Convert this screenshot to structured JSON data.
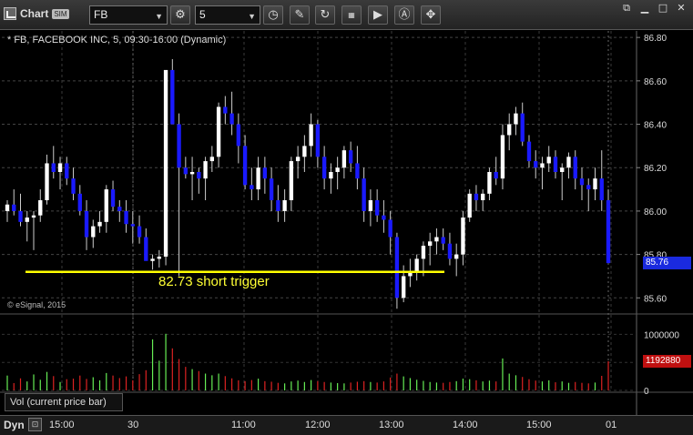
{
  "window": {
    "title": "Chart",
    "badge": "SIM",
    "symbol_value": "FB",
    "interval_value": "5"
  },
  "chart": {
    "title": "* FB, FACEBOOK INC, 5, 09:30-16:00 (Dynamic)",
    "copyright": "© eSignal, 2015",
    "volume_label": "Vol (current price bar)",
    "annotation": "82.73 short trigger",
    "last_price": "85.76",
    "last_volume": "1192880",
    "timebar_mode": "Dyn"
  },
  "colors": {
    "up_candle": "#ffffff",
    "down_candle": "#1a1aff",
    "trigger_line": "#ffff00",
    "vol_up": "#66ee55",
    "vol_down": "#dd2222",
    "last_price_badge": "#1a2adf",
    "last_volume_badge": "#c01010"
  },
  "chart_data": {
    "type": "candlestick",
    "price_axis": {
      "ticks": [
        "86.80",
        "86.60",
        "86.40",
        "86.20",
        "86.00",
        "85.80",
        "85.60"
      ],
      "ylim": [
        85.53,
        86.83
      ]
    },
    "volume_axis": {
      "ticks": [
        "1000000",
        "500000",
        "0"
      ],
      "ylim": [
        0,
        1250000
      ]
    },
    "time_axis": [
      "15:00",
      "30",
      "11:00",
      "12:00",
      "13:00",
      "14:00",
      "15:00",
      "01"
    ],
    "trigger_level": 85.72,
    "candles": [
      [
        86.0,
        86.05,
        85.95,
        86.03,
        265000
      ],
      [
        86.03,
        86.1,
        85.98,
        86.0,
        130000
      ],
      [
        86.0,
        86.08,
        85.93,
        85.95,
        215000
      ],
      [
        85.95,
        86.0,
        85.86,
        85.97,
        160000
      ],
      [
        85.97,
        86.0,
        85.82,
        85.98,
        285000
      ],
      [
        85.98,
        86.1,
        85.95,
        86.05,
        190000
      ],
      [
        86.05,
        86.26,
        86.03,
        86.22,
        330000
      ],
      [
        86.22,
        86.3,
        86.15,
        86.18,
        255000
      ],
      [
        86.18,
        86.25,
        86.1,
        86.22,
        150000
      ],
      [
        86.22,
        86.25,
        86.12,
        86.15,
        200000
      ],
      [
        86.15,
        86.2,
        86.05,
        86.08,
        210000
      ],
      [
        86.08,
        86.12,
        85.98,
        86.0,
        265000
      ],
      [
        86.0,
        86.05,
        85.82,
        85.88,
        205000
      ],
      [
        85.88,
        85.96,
        85.83,
        85.93,
        235000
      ],
      [
        85.93,
        86.0,
        85.9,
        85.95,
        180000
      ],
      [
        85.95,
        86.12,
        85.9,
        86.1,
        310000
      ],
      [
        86.1,
        86.14,
        86.0,
        86.02,
        265000
      ],
      [
        86.02,
        86.05,
        85.95,
        86.0,
        220000
      ],
      [
        86.0,
        86.05,
        85.9,
        85.94,
        250000
      ],
      [
        85.94,
        86.0,
        85.85,
        85.93,
        180000
      ],
      [
        85.93,
        85.98,
        85.85,
        85.88,
        290000
      ],
      [
        85.88,
        85.92,
        85.82,
        85.77,
        360000
      ],
      [
        85.77,
        85.8,
        85.73,
        85.78,
        910000
      ],
      [
        85.78,
        85.82,
        85.74,
        85.79,
        530000
      ],
      [
        85.79,
        86.6,
        85.75,
        86.65,
        1010000
      ],
      [
        86.65,
        86.7,
        86.5,
        86.4,
        750000
      ],
      [
        86.4,
        86.45,
        85.7,
        86.2,
        560000
      ],
      [
        86.2,
        86.25,
        86.15,
        86.17,
        420000
      ],
      [
        86.17,
        86.25,
        86.05,
        86.18,
        380000
      ],
      [
        86.18,
        86.2,
        86.08,
        86.15,
        345000
      ],
      [
        86.15,
        86.25,
        86.05,
        86.23,
        300000
      ],
      [
        86.23,
        86.3,
        86.18,
        86.25,
        270000
      ],
      [
        86.25,
        86.5,
        86.2,
        86.48,
        300000
      ],
      [
        86.48,
        86.53,
        86.4,
        86.45,
        255000
      ],
      [
        86.45,
        86.55,
        86.35,
        86.4,
        215000
      ],
      [
        86.4,
        86.45,
        86.22,
        86.3,
        180000
      ],
      [
        86.3,
        86.35,
        86.1,
        86.12,
        165000
      ],
      [
        86.12,
        86.2,
        86.05,
        86.1,
        185000
      ],
      [
        86.1,
        86.25,
        86.05,
        86.2,
        210000
      ],
      [
        86.2,
        86.25,
        86.08,
        86.15,
        165000
      ],
      [
        86.15,
        86.2,
        86.0,
        86.05,
        155000
      ],
      [
        86.05,
        86.12,
        85.95,
        86.0,
        135000
      ],
      [
        86.0,
        86.1,
        85.95,
        86.05,
        125000
      ],
      [
        86.05,
        86.25,
        86.0,
        86.23,
        160000
      ],
      [
        86.23,
        86.3,
        86.15,
        86.25,
        175000
      ],
      [
        86.25,
        86.35,
        86.18,
        86.3,
        150000
      ],
      [
        86.3,
        86.45,
        86.25,
        86.4,
        185000
      ],
      [
        86.4,
        86.42,
        86.2,
        86.25,
        165000
      ],
      [
        86.25,
        86.3,
        86.1,
        86.15,
        150000
      ],
      [
        86.15,
        86.22,
        86.08,
        86.18,
        140000
      ],
      [
        86.18,
        86.25,
        86.1,
        86.2,
        130000
      ],
      [
        86.2,
        86.3,
        86.15,
        86.28,
        125000
      ],
      [
        86.28,
        86.32,
        86.18,
        86.22,
        140000
      ],
      [
        86.22,
        86.3,
        86.1,
        86.15,
        155000
      ],
      [
        86.15,
        86.2,
        85.95,
        86.0,
        165000
      ],
      [
        86.0,
        86.1,
        85.93,
        86.05,
        150000
      ],
      [
        86.05,
        86.1,
        85.95,
        85.98,
        140000
      ],
      [
        85.98,
        86.05,
        85.9,
        85.96,
        160000
      ],
      [
        85.96,
        86.0,
        85.8,
        85.88,
        230000
      ],
      [
        85.88,
        85.9,
        85.55,
        85.6,
        300000
      ],
      [
        85.6,
        85.75,
        85.58,
        85.7,
        250000
      ],
      [
        85.7,
        85.78,
        85.65,
        85.72,
        220000
      ],
      [
        85.72,
        85.8,
        85.68,
        85.78,
        190000
      ],
      [
        85.78,
        85.86,
        85.7,
        85.84,
        170000
      ],
      [
        85.84,
        85.9,
        85.75,
        85.86,
        150000
      ],
      [
        85.86,
        85.92,
        85.8,
        85.88,
        140000
      ],
      [
        85.88,
        85.92,
        85.82,
        85.85,
        135000
      ],
      [
        85.85,
        85.9,
        85.75,
        85.78,
        150000
      ],
      [
        85.78,
        85.85,
        85.7,
        85.8,
        165000
      ],
      [
        85.8,
        86.0,
        85.75,
        85.97,
        210000
      ],
      [
        85.97,
        86.1,
        85.95,
        86.08,
        200000
      ],
      [
        86.08,
        86.12,
        86.0,
        86.05,
        180000
      ],
      [
        86.05,
        86.1,
        86.0,
        86.08,
        160000
      ],
      [
        86.08,
        86.2,
        86.05,
        86.18,
        175000
      ],
      [
        86.18,
        86.25,
        86.12,
        86.15,
        160000
      ],
      [
        86.15,
        86.4,
        86.1,
        86.35,
        570000
      ],
      [
        86.35,
        86.45,
        86.28,
        86.4,
        300000
      ],
      [
        86.4,
        86.48,
        86.35,
        86.45,
        270000
      ],
      [
        86.45,
        86.5,
        86.3,
        86.32,
        240000
      ],
      [
        86.32,
        86.35,
        86.2,
        86.23,
        200000
      ],
      [
        86.23,
        86.28,
        86.15,
        86.2,
        175000
      ],
      [
        86.2,
        86.25,
        86.1,
        86.22,
        160000
      ],
      [
        86.22,
        86.3,
        86.18,
        86.25,
        180000
      ],
      [
        86.25,
        86.28,
        86.15,
        86.18,
        145000
      ],
      [
        86.18,
        86.22,
        86.05,
        86.2,
        160000
      ],
      [
        86.2,
        86.27,
        86.15,
        86.25,
        135000
      ],
      [
        86.25,
        86.28,
        86.1,
        86.15,
        150000
      ],
      [
        86.15,
        86.2,
        86.05,
        86.12,
        135000
      ],
      [
        86.12,
        86.15,
        86.0,
        86.1,
        125000
      ],
      [
        86.1,
        86.2,
        86.05,
        86.15,
        140000
      ],
      [
        86.15,
        86.28,
        86.0,
        86.05,
        260000
      ],
      [
        86.05,
        86.1,
        85.78,
        85.76,
        520000
      ]
    ]
  }
}
